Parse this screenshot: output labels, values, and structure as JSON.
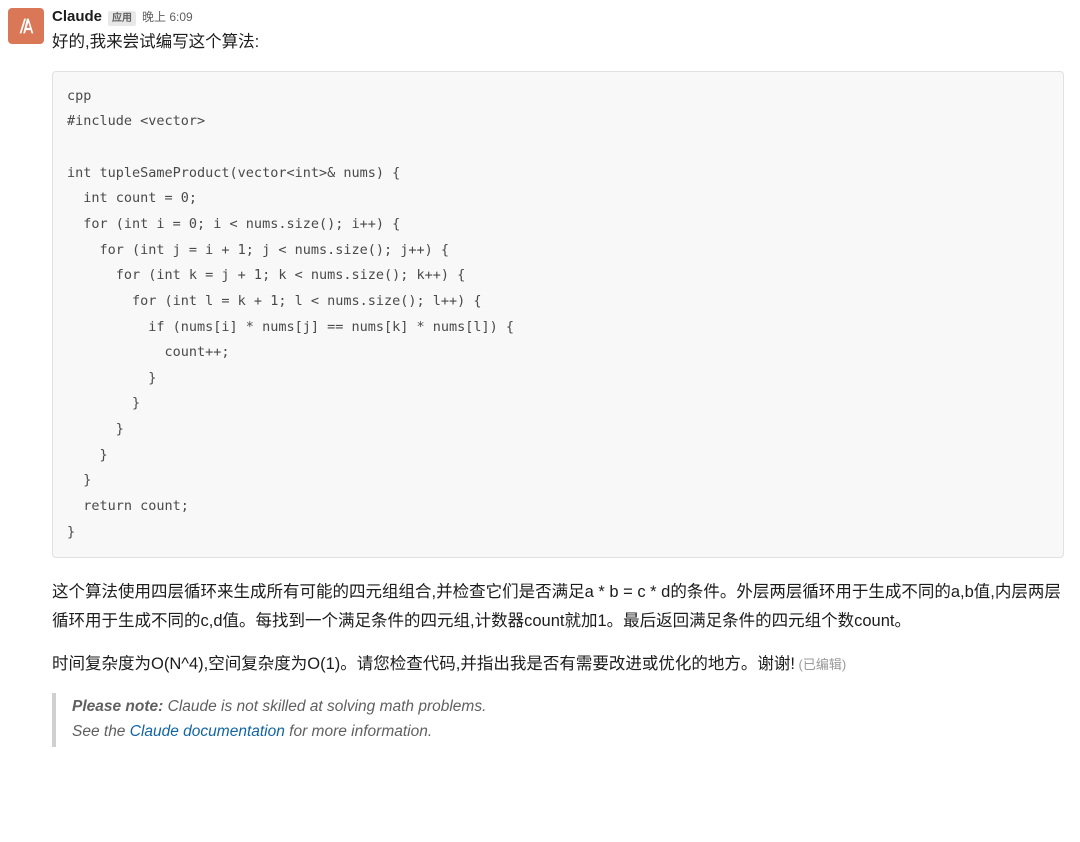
{
  "message": {
    "sender": "Claude",
    "app_badge": "应用",
    "timestamp": "晚上 6:09",
    "intro_text": "好的,我来尝试编写这个算法:"
  },
  "code": {
    "content": "cpp\n#include <vector>\n\nint tupleSameProduct(vector<int>& nums) {\n  int count = 0;\n  for (int i = 0; i < nums.size(); i++) {\n    for (int j = i + 1; j < nums.size(); j++) {\n      for (int k = j + 1; k < nums.size(); k++) {\n        for (int l = k + 1; l < nums.size(); l++) {\n          if (nums[i] * nums[j] == nums[k] * nums[l]) {\n            count++;\n          }\n        }\n      }\n    }\n  }\n  return count;\n}"
  },
  "explanation": {
    "para1": "这个算法使用四层循环来生成所有可能的四元组组合,并检查它们是否满足a * b = c * d的条件。外层两层循环用于生成不同的a,b值,内层两层循环用于生成不同的c,d值。每找到一个满足条件的四元组,计数器count就加1。最后返回满足条件的四元组个数count。",
    "para2_prefix": "时间复杂度为O(N^4),空间复杂度为O(1)。请您检查代码,并指出我是否有需要改进或优化的地方。谢谢!",
    "edited": " (已编辑)"
  },
  "note": {
    "bold_prefix": "Please note:",
    "line1_rest": " Claude is not skilled at solving math problems.",
    "line2_prefix": "See the ",
    "link_text": "Claude documentation",
    "line2_suffix": " for more information."
  }
}
